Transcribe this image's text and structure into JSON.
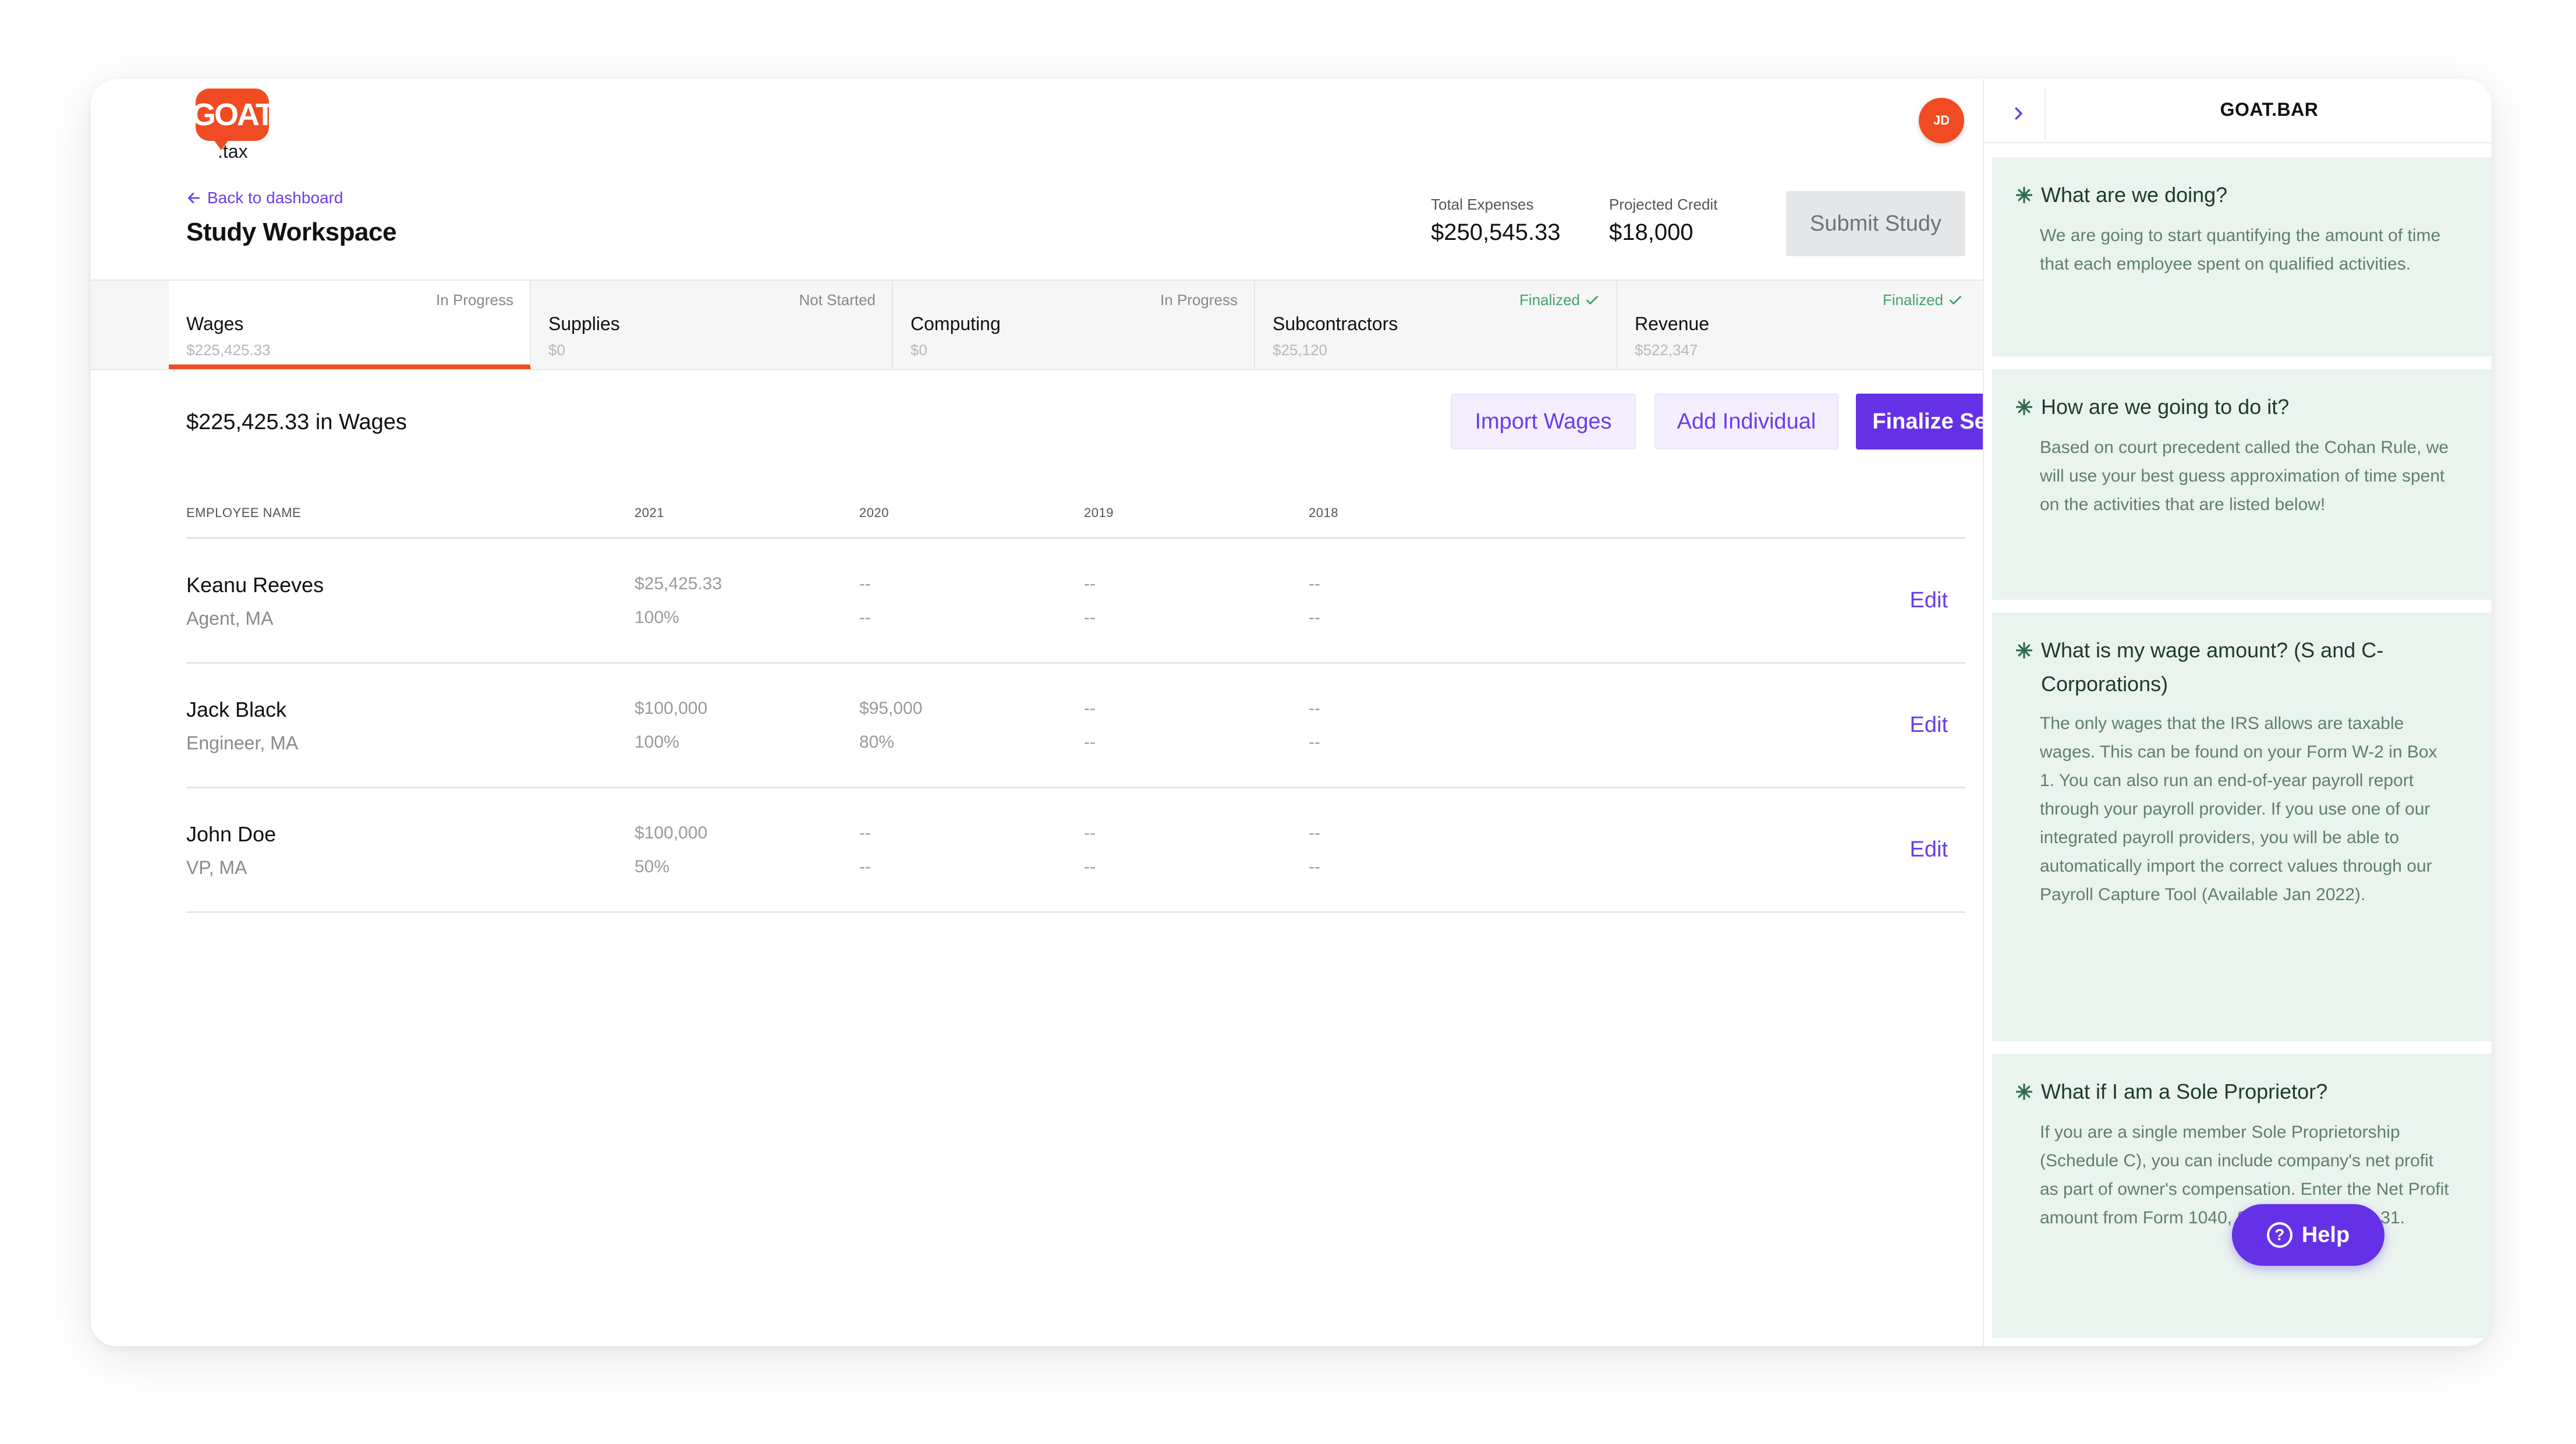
{
  "header": {
    "logo_main": "GOAT",
    "logo_sub": ".tax",
    "avatar_initials": "JD",
    "back_link": "Back to dashboard",
    "title": "Study Workspace",
    "stats": [
      {
        "label": "Total Expenses",
        "value": "$250,545.33"
      },
      {
        "label": "Projected Credit",
        "value": "$18,000"
      }
    ],
    "submit_label": "Submit Study"
  },
  "tabs": [
    {
      "name": "Wages",
      "status": "In Progress",
      "amount": "$225,425.33",
      "done": false
    },
    {
      "name": "Supplies",
      "status": "Not Started",
      "amount": "$0",
      "done": false
    },
    {
      "name": "Computing",
      "status": "In Progress",
      "amount": "$0",
      "done": false
    },
    {
      "name": "Subcontractors",
      "status": "Finalized",
      "amount": "$25,120",
      "done": true
    },
    {
      "name": "Revenue",
      "status": "Finalized",
      "amount": "$522,347",
      "done": true
    }
  ],
  "section": {
    "title": "$225,425.33 in Wages",
    "import_label": "Import Wages",
    "add_label": "Add Individual",
    "finalize_label": "Finalize Section"
  },
  "table": {
    "columns": [
      "EMPLOYEE NAME",
      "2021",
      "2020",
      "2019",
      "2018"
    ],
    "edit_label": "Edit",
    "rows": [
      {
        "name": "Keanu Reeves",
        "role": "Agent, MA",
        "years": [
          [
            "$25,425.33",
            "100%"
          ],
          [
            "--",
            "--"
          ],
          [
            "--",
            "--"
          ],
          [
            "--",
            "--"
          ]
        ]
      },
      {
        "name": "Jack Black",
        "role": "Engineer, MA",
        "years": [
          [
            "$100,000",
            "100%"
          ],
          [
            "$95,000",
            "80%"
          ],
          [
            "--",
            "--"
          ],
          [
            "--",
            "--"
          ]
        ]
      },
      {
        "name": "John Doe",
        "role": "VP, MA",
        "years": [
          [
            "$100,000",
            "50%"
          ],
          [
            "--",
            "--"
          ],
          [
            "--",
            "--"
          ],
          [
            "--",
            "--"
          ]
        ]
      }
    ]
  },
  "sidebar": {
    "title": "GOAT.BAR",
    "faqs": [
      {
        "q": "What are we doing?",
        "a": "We are going to start quantifying the amount of time that each employee spent on qualified activities."
      },
      {
        "q": "How are we going to do it?",
        "a": "Based on court precedent called the Cohan Rule, we will use your best guess approximation of time spent on the activities that are listed below!"
      },
      {
        "q": "What is my wage amount? (S and C-Corporations)",
        "a": "The only wages that the IRS allows are taxable wages. This can be found on your Form W-2 in Box 1. You can also run an end-of-year payroll report through your payroll provider. If you use one of our integrated payroll providers, you will be able to automatically import the correct values through our Payroll Capture Tool (Available Jan 2022)."
      },
      {
        "q": "What if I am a Sole Proprietor?",
        "a": "If you are a single member Sole Proprietorship (Schedule C), you can include company's net profit as part of owner's compensation. Enter the Net Profit amount from Form 1040, Schedule C - Line 31."
      }
    ]
  },
  "help": {
    "label": "Help",
    "icon_glyph": "?"
  },
  "colors": {
    "brand": "#f04b23",
    "accent": "#6431e6",
    "finalized": "#43a36a",
    "faq_bg": "#e9f4ef"
  }
}
